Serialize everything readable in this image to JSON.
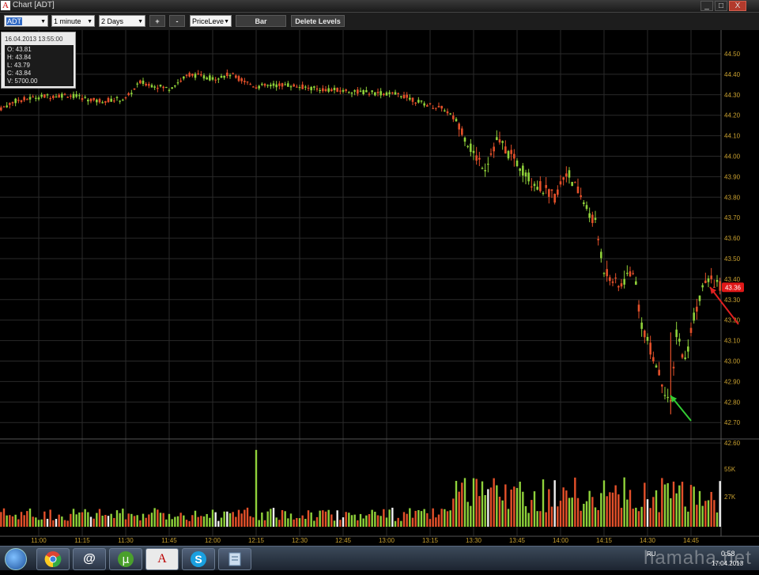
{
  "window": {
    "title": "Chart [ADT]",
    "app_icon_glyph": "A",
    "controls": {
      "minimize": "_",
      "maximize": "□",
      "close": "X"
    }
  },
  "toolbar": {
    "symbol": "ADT",
    "interval": "1 minute",
    "range": "2 Days",
    "plus_label": "+",
    "minus_label": "-",
    "price_mode": "PriceLeve",
    "style_label": "Bar",
    "delete_levels_label": "Delete Levels"
  },
  "info_panel": {
    "timestamp": "16.04.2013 13:55:00",
    "open": "O: 43.81",
    "high": "H: 43.84",
    "low": "L: 43.79",
    "close": "C: 43.84",
    "volume": "V: 5700.00"
  },
  "colors": {
    "up": "#8fd13a",
    "down": "#e4502a",
    "grid": "#2a2a2a",
    "axis_text": "#c8a030",
    "price_marker": "#e01818",
    "arrow_red": "#e02020",
    "arrow_green": "#33cc33"
  },
  "chart_data": {
    "type": "candlestick",
    "price_axis": [
      "44.50",
      "44.40",
      "44.30",
      "44.20",
      "44.10",
      "44.00",
      "43.90",
      "43.80",
      "43.70",
      "43.60",
      "43.50",
      "43.40",
      "43.30",
      "43.20",
      "43.10",
      "43.00",
      "42.90",
      "42.80",
      "42.70",
      "42.60"
    ],
    "price_range": [
      42.6,
      44.5
    ],
    "time_axis": [
      "11:00",
      "11:15",
      "11:30",
      "11:45",
      "12:00",
      "12:15",
      "12:30",
      "12:45",
      "13:00",
      "13:15",
      "13:30",
      "13:45",
      "14:00",
      "14:15",
      "14:30",
      "14:45"
    ],
    "volume_axis": [
      "55K",
      "27K"
    ],
    "current_price": "43.36",
    "price_path": [
      [
        "10:45",
        44.22
      ],
      [
        "10:52",
        44.27
      ],
      [
        "11:00",
        44.29
      ],
      [
        "11:10",
        44.3
      ],
      [
        "11:20",
        44.27
      ],
      [
        "11:30",
        44.28
      ],
      [
        "11:35",
        44.36
      ],
      [
        "11:45",
        44.33
      ],
      [
        "11:52",
        44.4
      ],
      [
        "12:00",
        44.38
      ],
      [
        "12:06",
        44.4
      ],
      [
        "12:15",
        44.34
      ],
      [
        "12:25",
        44.35
      ],
      [
        "12:35",
        44.33
      ],
      [
        "12:45",
        44.32
      ],
      [
        "12:55",
        44.31
      ],
      [
        "13:05",
        44.3
      ],
      [
        "13:12",
        44.26
      ],
      [
        "13:20",
        44.23
      ],
      [
        "13:25",
        44.16
      ],
      [
        "13:30",
        44.01
      ],
      [
        "13:34",
        43.95
      ],
      [
        "13:38",
        44.08
      ],
      [
        "13:45",
        43.97
      ],
      [
        "13:50",
        43.88
      ],
      [
        "13:58",
        43.8
      ],
      [
        "14:02",
        43.93
      ],
      [
        "14:07",
        43.8
      ],
      [
        "14:12",
        43.67
      ],
      [
        "14:15",
        43.45
      ],
      [
        "14:20",
        43.36
      ],
      [
        "14:25",
        43.45
      ],
      [
        "14:28",
        43.18
      ],
      [
        "14:32",
        43.02
      ],
      [
        "14:35",
        42.9
      ],
      [
        "14:38",
        42.78
      ],
      [
        "14:40",
        43.14
      ],
      [
        "14:43",
        43.0
      ],
      [
        "14:46",
        43.22
      ],
      [
        "14:49",
        43.36
      ],
      [
        "14:52",
        43.4
      ],
      [
        "14:55",
        43.36
      ]
    ],
    "volume_spike_time": "12:15",
    "annotations": [
      "red-arrow-at-current-price",
      "green-arrow-at-low"
    ]
  },
  "taskbar": {
    "apps": [
      "chrome-icon",
      "mail-agent-icon",
      "utorrent-icon",
      "broker-terminal-icon",
      "skype-icon",
      "notes-icon"
    ],
    "lang": "RU",
    "time": "0:58",
    "date": "17.04.2013"
  },
  "watermark": "hamaha.net"
}
